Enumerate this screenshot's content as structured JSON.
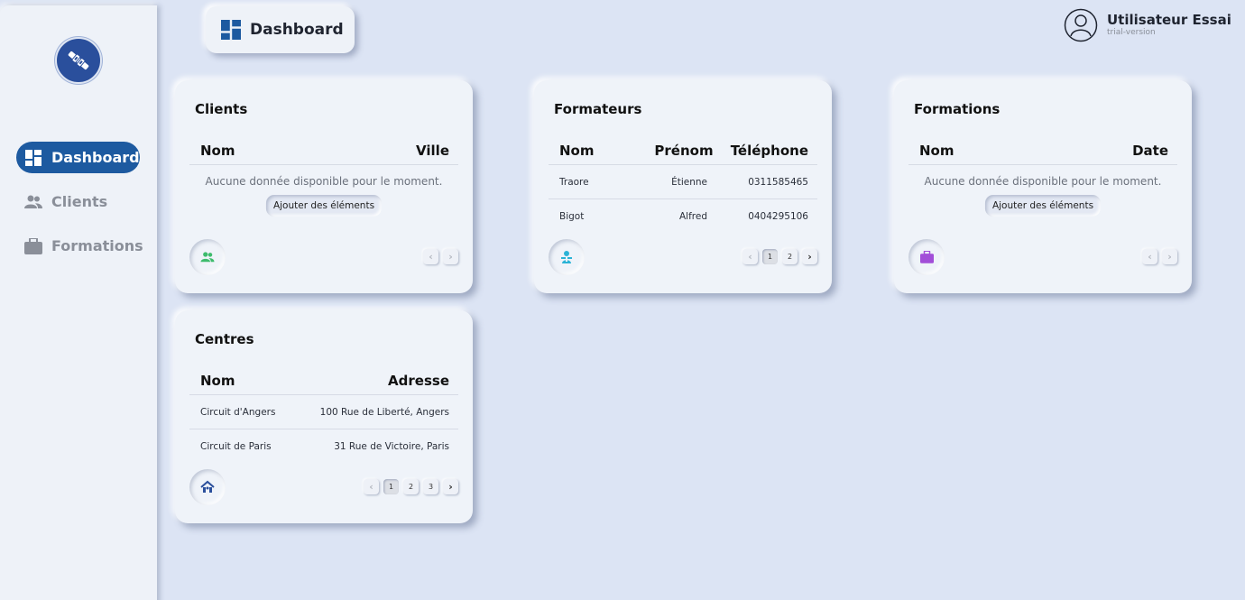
{
  "sidebar": {
    "items": [
      {
        "label": "Dashboard",
        "icon": "dashboard-icon",
        "active": true
      },
      {
        "label": "Clients",
        "icon": "users-icon",
        "active": false
      },
      {
        "label": "Formations",
        "icon": "briefcase-icon",
        "active": false
      }
    ]
  },
  "header": {
    "title": "Dashboard",
    "user_name": "Utilisateur Essai",
    "user_subtitle": "trial-version"
  },
  "colors": {
    "accent": "#1d5aa0",
    "background": "#dce4f4",
    "clients_icon": "#3dbb6c",
    "formateurs_icon": "#2bb3d6",
    "formations_icon": "#a24ed8",
    "centres_icon": "#2a4f9c"
  },
  "cards": {
    "clients": {
      "title": "Clients",
      "columns": [
        "Nom",
        "Ville"
      ],
      "empty_text": "Aucune donnée disponible pour le moment.",
      "add_label": "Ajouter des éléments",
      "icon": "users-icon",
      "pagination": {
        "prev": "‹",
        "next": "›",
        "pages": []
      }
    },
    "formateurs": {
      "title": "Formateurs",
      "columns": [
        "Nom",
        "Prénom",
        "Téléphone"
      ],
      "rows": [
        [
          "Traore",
          "Étienne",
          "0311585465"
        ],
        [
          "Bigot",
          "Alfred",
          "0404295106"
        ]
      ],
      "icon": "trainer-icon",
      "pagination": {
        "prev": "‹",
        "next": "›",
        "pages": [
          "1",
          "2"
        ],
        "current": "1"
      }
    },
    "formations": {
      "title": "Formations",
      "columns": [
        "Nom",
        "Date"
      ],
      "empty_text": "Aucune donnée disponible pour le moment.",
      "add_label": "Ajouter des éléments",
      "icon": "briefcase-icon",
      "pagination": {
        "prev": "‹",
        "next": "›",
        "pages": []
      }
    },
    "centres": {
      "title": "Centres",
      "columns": [
        "Nom",
        "Adresse"
      ],
      "rows": [
        [
          "Circuit d'Angers",
          "100 Rue de Liberté, Angers"
        ],
        [
          "Circuit de Paris",
          "31 Rue de Victoire, Paris"
        ]
      ],
      "icon": "house-icon",
      "pagination": {
        "prev": "‹",
        "next": "›",
        "pages": [
          "1",
          "2",
          "3"
        ],
        "current": "1"
      }
    }
  }
}
